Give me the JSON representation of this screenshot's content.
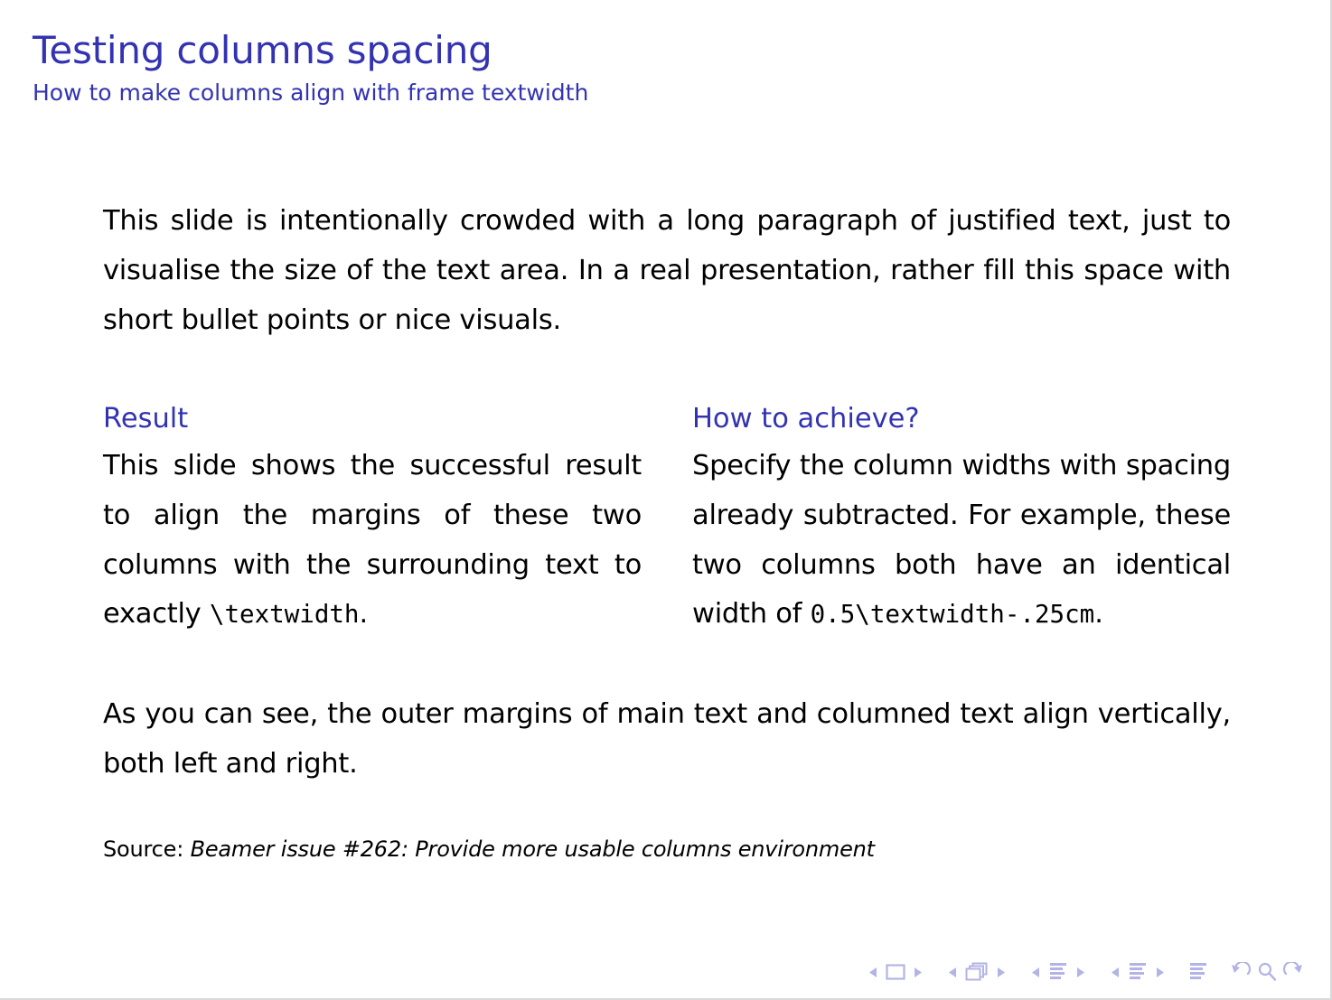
{
  "slide": {
    "title": "Testing columns spacing",
    "subtitle": "How to make columns align with frame textwidth",
    "accent_color": "#3333b2",
    "text_color": "#000000",
    "background_color": "#ffffff",
    "nav_color": "#b3b3e6"
  },
  "body": {
    "intro_paragraph": "This slide is intentionally crowded with a long paragraph of justified text, just to visualise the size of the text area. In a real presentation, rather fill this space with short bullet points or nice visuals.",
    "closing_paragraph": "As you can see, the outer margins of main text and columned text align vertically, both left and right."
  },
  "columns": [
    {
      "heading": "Result",
      "text_before_code": "This slide shows the successful result to align the margins of these two columns with the surrounding text to exactly ",
      "code": "\\textwidth",
      "text_after_code": "."
    },
    {
      "heading": "How to achieve?",
      "text_before_code": "Specify the column widths with spacing already subtracted. For example, these two columns both have an identical width of ",
      "code": "0.5\\textwidth-.25cm",
      "text_after_code": "."
    }
  ],
  "source": {
    "label": "Source:",
    "citation": "Beamer issue #262: Provide more usable columns environment"
  },
  "navigation": {
    "icons": [
      "prev-slide-arrow-icon",
      "slide-icon",
      "next-slide-arrow-icon",
      "prev-frame-arrow-icon",
      "frames-icon",
      "next-frame-arrow-icon",
      "prev-subsection-arrow-icon",
      "subsection-icon",
      "next-subsection-arrow-icon",
      "prev-section-arrow-icon",
      "section-icon",
      "next-section-arrow-icon",
      "presentation-icon",
      "back-arrow-icon",
      "search-icon",
      "forward-arrow-icon"
    ]
  }
}
